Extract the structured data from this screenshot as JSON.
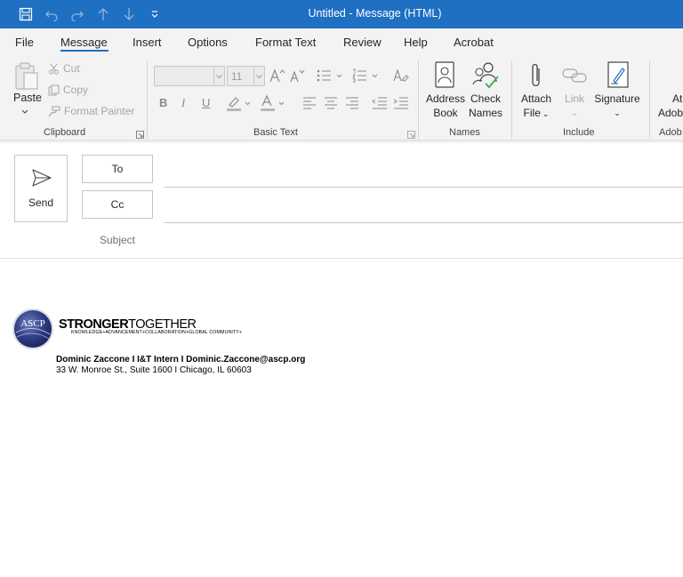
{
  "window": {
    "title": "Untitled  -  Message (HTML)",
    "accent_color": "#1f6fc2"
  },
  "quick_access": {
    "icons": [
      "save-icon",
      "undo-icon",
      "redo-icon",
      "up-arrow-icon",
      "down-arrow-icon",
      "customize-qat-icon"
    ]
  },
  "menu": {
    "tabs": [
      "File",
      "Message",
      "Insert",
      "Options",
      "Format Text",
      "Review",
      "Help",
      "Acrobat"
    ],
    "active": "Message"
  },
  "ribbon": {
    "clipboard": {
      "label": "Clipboard",
      "paste": "Paste",
      "cut": "Cut",
      "copy": "Copy",
      "format_painter": "Format Painter"
    },
    "basic_text": {
      "label": "Basic Text",
      "font_name": "",
      "font_size": "11",
      "bold": "B",
      "italic": "I",
      "underline": "U"
    },
    "names": {
      "label": "Names",
      "address_book_line1": "Address",
      "address_book_line2": "Book",
      "check_names_line1": "Check",
      "check_names_line2": "Names"
    },
    "include": {
      "label": "Include",
      "attach_line1": "Attach",
      "attach_line2": "File",
      "link": "Link",
      "signature": "Signature"
    },
    "adobe": {
      "label": "Adob",
      "btn_line1": "At",
      "btn_line2": "Adob"
    }
  },
  "compose": {
    "send": "Send",
    "to": "To",
    "cc": "Cc",
    "subject": "Subject",
    "to_value": "",
    "cc_value": "",
    "subject_value": ""
  },
  "signature": {
    "headline_bold": "STRONGER",
    "headline_light": "TOGETHER",
    "tagline": "KNOWLEDGE+ADVANCEMENT+COLLABORATION+GLOBAL COMMUNITY+",
    "logo_text": "ASCP",
    "line1": "Dominic Zaccone  I  I&T Intern   I  Dominic.Zaccone@ascp.org",
    "line2": "33 W. Monroe St., Suite 1600  I  Chicago, IL 60603"
  }
}
